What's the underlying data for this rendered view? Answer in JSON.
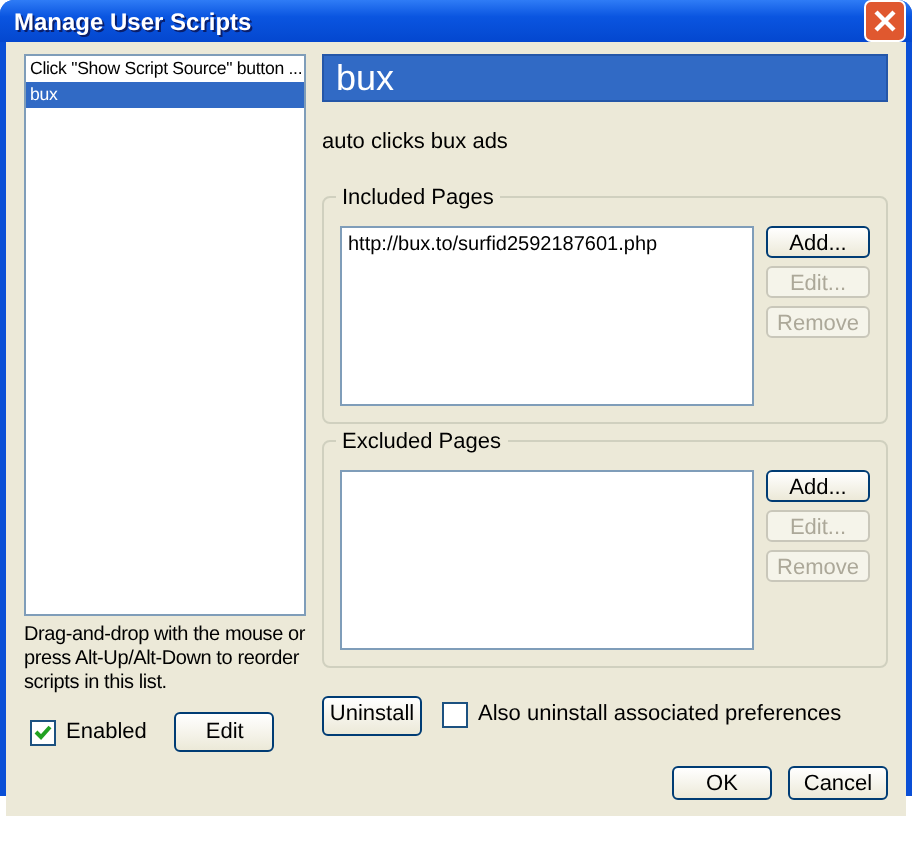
{
  "window": {
    "title": "Manage User Scripts"
  },
  "scripts": [
    {
      "name": "Click \"Show Script Source\" button ...",
      "selected": false
    },
    {
      "name": "bux",
      "selected": true
    }
  ],
  "reorder_hint": "Drag-and-drop with the mouse or press Alt-Up/Alt-Down to reorder scripts in this list.",
  "enabled": {
    "label": "Enabled",
    "checked": true
  },
  "edit_button": "Edit",
  "script_title": "bux",
  "description": "auto clicks bux ads",
  "page_groups": [
    {
      "title": "Included Pages",
      "pages": [
        "http://bux.to/surfid2592187601.php"
      ],
      "buttons": [
        {
          "label": "Add...",
          "disabled": false
        },
        {
          "label": "Edit...",
          "disabled": true
        },
        {
          "label": "Remove",
          "disabled": true
        }
      ]
    },
    {
      "title": "Excluded Pages",
      "buttons": [
        {
          "label": "Add...",
          "disabled": false
        },
        {
          "label": "Edit...",
          "disabled": true
        },
        {
          "label": "Remove",
          "disabled": true
        }
      ]
    }
  ],
  "uninstall_button": "Uninstall",
  "uninstall_prefs": {
    "label": "Also uninstall associated preferences",
    "checked": false
  },
  "buttons": [
    "OK",
    "Cancel"
  ]
}
